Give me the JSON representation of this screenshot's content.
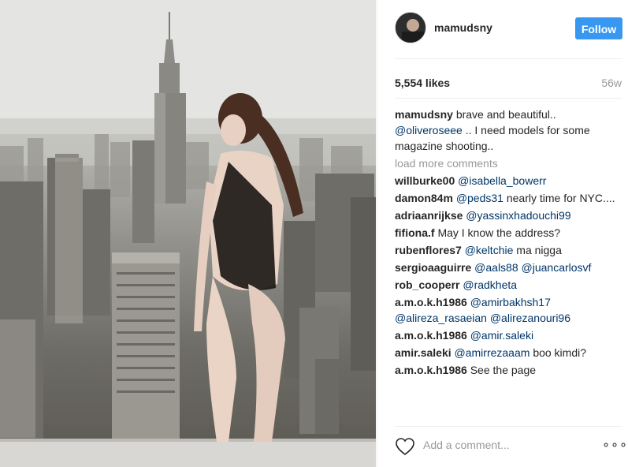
{
  "post": {
    "username": "mamudsny",
    "follow_label": "Follow",
    "likes": "5,554 likes",
    "time": "56w",
    "caption": {
      "user": "mamudsny",
      "text_1": "brave and beautiful..",
      "mention": "@oliveroseee",
      "text_2": ".. I need models for some magazine shooting.."
    },
    "load_more": "load more comments",
    "comments": [
      {
        "user": "willburke00",
        "mention": "@isabella_bowerr",
        "text": ""
      },
      {
        "user": "damon84m",
        "mention": "@peds31",
        "text": "nearly time for NYC...."
      },
      {
        "user": "adriaanrijkse",
        "mention": "@yassinxhadouchi99",
        "text": ""
      },
      {
        "user": "fifiona.f",
        "mention": "",
        "text": "May I know the address?"
      },
      {
        "user": "rubenflores7",
        "mention": "@keltchie",
        "text": "ma nigga"
      },
      {
        "user": "sergioaaguirre",
        "mention": "@aals88",
        "mention_2": "@juancarlosvf",
        "text": ""
      },
      {
        "user": "rob_cooperr",
        "mention": "@radkheta",
        "text": ""
      },
      {
        "user": "a.m.o.k.h1986",
        "mention": "@amirbakhsh17",
        "mention_2": "@alireza_rasaeian",
        "mention_3": "@alirezanouri96",
        "text": ""
      },
      {
        "user": "a.m.o.k.h1986",
        "mention": "@amir.saleki",
        "text": ""
      },
      {
        "user": "amir.saleki",
        "mention": "@amirrezaaam",
        "text": "boo kimdi?"
      },
      {
        "user": "a.m.o.k.h1986",
        "mention": "",
        "text": "See the page"
      }
    ],
    "add_comment_placeholder": "Add a comment...",
    "more_options": "∘∘∘"
  },
  "icons": {
    "heart": "heart-icon",
    "more": "more-options-icon"
  },
  "colors": {
    "follow_button": "#3897f0",
    "mention": "#003569",
    "muted": "#999999",
    "text": "#262626"
  }
}
